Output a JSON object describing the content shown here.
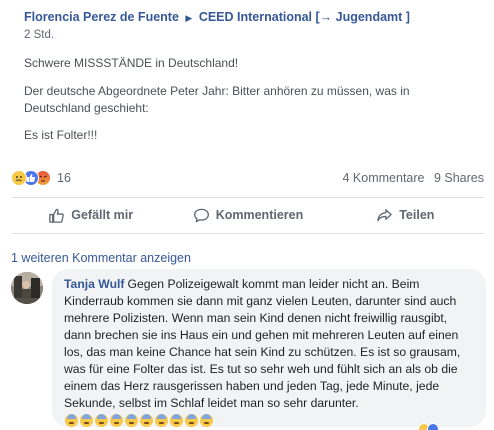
{
  "post": {
    "author": "Florencia Perez de Fuente",
    "arrow": "▶",
    "group": "CEED International [→ Jugendamt ]",
    "time": "2 Std.",
    "paragraphs": [
      "Schwere MISSSTÄNDE in Deutschland!",
      "Der deutsche Abgeordnete Peter Jahr: Bitter anhören zu müssen, was in Deutschland geschieht:",
      "Es ist Folter!!!"
    ]
  },
  "reactions": {
    "icons": [
      "sad-reaction",
      "like-reaction",
      "angry-reaction"
    ],
    "count": "16"
  },
  "stats": {
    "comments": "4 Kommentare",
    "shares": "9 Shares"
  },
  "actions": {
    "like": "Gefällt mir",
    "comment": "Kommentieren",
    "share": "Teilen"
  },
  "comments": {
    "more_label": "1 weiteren Kommentar anzeigen",
    "items": [
      {
        "author": "Tanja Wulf",
        "text": "Gegen Polizeigewalt kommt man leider nicht an. Beim Kinderraub kommen sie dann mit ganz vielen Leuten, darunter sind auch mehrere Polizisten. Wenn man sein Kind denen nicht freiwillig rausgibt, dann brechen sie ins Haus ein und gehen mit mehreren Leuten auf einen los, das man keine Chance hat sein Kind zu schützen. Es ist so grausam, was für eine Folter das ist. Es tut so sehr weh und fühlt sich an als ob die einem das Herz rausgerissen haben und jeden Tag, jede Minute, jede Sekunde, selbst im Schlaf leidet man so sehr darunter.",
        "emoji": "anxious-face-icon",
        "emoji_count": 10
      }
    ]
  },
  "colors": {
    "link": "#365899",
    "muted": "#616770",
    "bubble": "#f2f3f5"
  }
}
